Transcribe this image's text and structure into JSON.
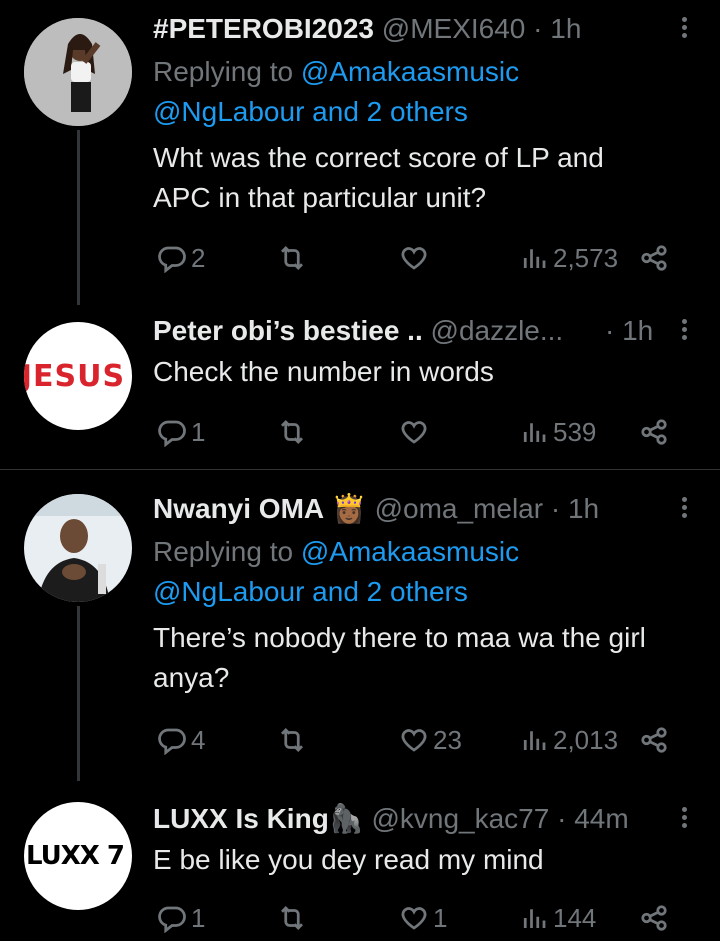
{
  "tweets": [
    {
      "name": "#PETEROBI2023",
      "handle": "@MEXI640",
      "time": "· 1h",
      "replying_prefix": "Replying to ",
      "replying_to_1": "@Amakaasmusic",
      "replying_to_2": "@NgLabour and 2 others",
      "text_line1": "Wht was the correct score of LP and",
      "text_line2": "APC in that particular unit?",
      "replies": "2",
      "retweets": "",
      "likes": "",
      "views": "2,573"
    },
    {
      "name": "Peter obi’s bestiee ..",
      "handle": "@dazzle...",
      "time": "· 1h",
      "text_line1": "Check the number in words",
      "avatar_text": "JESUS",
      "replies": "1",
      "retweets": "",
      "likes": "",
      "views": "539"
    },
    {
      "name": "Nwanyi OMA",
      "name_emoji": "👸🏾",
      "handle": "@oma_melar",
      "time": "· 1h",
      "replying_prefix": "Replying to ",
      "replying_to_1": "@Amakaasmusic",
      "replying_to_2": "@NgLabour and 2 others",
      "text_line1": "There’s nobody there to maa wa the girl",
      "text_line2": "anya?",
      "replies": "4",
      "retweets": "",
      "likes": "23",
      "views": "2,013"
    },
    {
      "name": "LUXX Is King",
      "name_emoji": "🦍",
      "handle": "@kvng_kac77",
      "time": "· 44m",
      "text_line1": "E be like you dey read my mind",
      "avatar_text": "LUXX 7",
      "replies": "1",
      "retweets": "",
      "likes": "1",
      "views": "144"
    }
  ],
  "colors": {
    "background": "#000000",
    "text": "#e7e9ea",
    "muted": "#71767b",
    "link": "#1d9bf0",
    "divider": "#2f3336"
  }
}
